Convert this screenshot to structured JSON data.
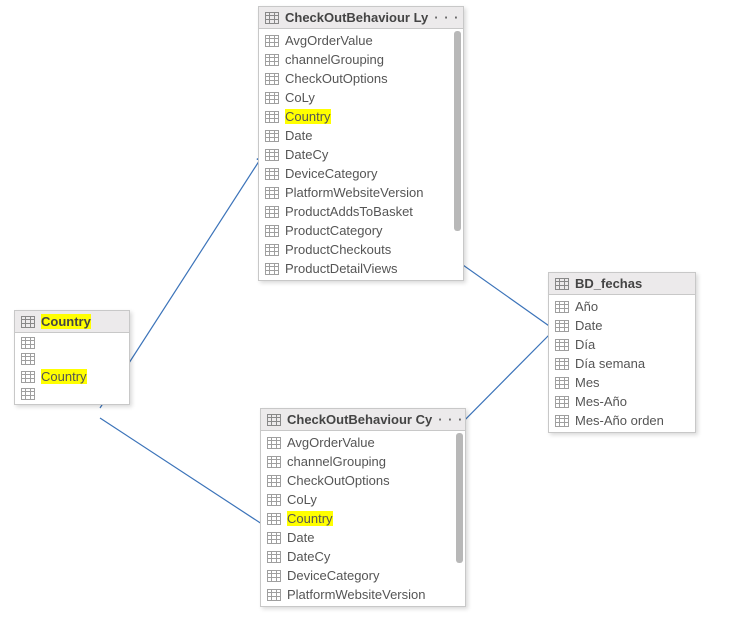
{
  "tables": {
    "country_small": {
      "title": "Country",
      "title_highlight": true,
      "fields": [
        {
          "label": "",
          "highlight": false
        },
        {
          "label": "",
          "highlight": false
        },
        {
          "label": "Country",
          "highlight": true
        },
        {
          "label": "",
          "highlight": false
        }
      ]
    },
    "checkout_ly": {
      "title": "CheckOutBehaviour Ly",
      "ellipsis": "· · ·",
      "fields": [
        {
          "label": "AvgOrderValue",
          "highlight": false
        },
        {
          "label": "channelGrouping",
          "highlight": false
        },
        {
          "label": "CheckOutOptions",
          "highlight": false
        },
        {
          "label": "CoLy",
          "highlight": false
        },
        {
          "label": "Country",
          "highlight": true
        },
        {
          "label": "Date",
          "highlight": false
        },
        {
          "label": "DateCy",
          "highlight": false
        },
        {
          "label": "DeviceCategory",
          "highlight": false
        },
        {
          "label": "PlatformWebsiteVersion",
          "highlight": false
        },
        {
          "label": "ProductAddsToBasket",
          "highlight": false
        },
        {
          "label": "ProductCategory",
          "highlight": false
        },
        {
          "label": "ProductCheckouts",
          "highlight": false
        },
        {
          "label": "ProductDetailViews",
          "highlight": false
        }
      ]
    },
    "checkout_cy": {
      "title": "CheckOutBehaviour Cy",
      "ellipsis": "· · ·",
      "fields": [
        {
          "label": "AvgOrderValue",
          "highlight": false
        },
        {
          "label": "channelGrouping",
          "highlight": false
        },
        {
          "label": "CheckOutOptions",
          "highlight": false
        },
        {
          "label": "CoLy",
          "highlight": false
        },
        {
          "label": "Country",
          "highlight": true
        },
        {
          "label": "Date",
          "highlight": false
        },
        {
          "label": "DateCy",
          "highlight": false
        },
        {
          "label": "DeviceCategory",
          "highlight": false
        },
        {
          "label": "PlatformWebsiteVersion",
          "highlight": false
        }
      ]
    },
    "bd_fechas": {
      "title": "BD_fechas",
      "fields": [
        {
          "label": "Año",
          "highlight": false
        },
        {
          "label": "Date",
          "highlight": false
        },
        {
          "label": "Día",
          "highlight": false
        },
        {
          "label": "Día semana",
          "highlight": false
        },
        {
          "label": "Mes",
          "highlight": false
        },
        {
          "label": "Mes-Año",
          "highlight": false
        },
        {
          "label": "Mes-Año orden",
          "highlight": false
        }
      ]
    }
  },
  "connections": [
    {
      "from": "country_small.Country",
      "to": "checkout_ly.Country"
    },
    {
      "from": "country_small.Country",
      "to": "checkout_cy.Country"
    },
    {
      "from": "bd_fechas.Date",
      "to": "checkout_ly.Date"
    },
    {
      "from": "bd_fechas.Date",
      "to": "checkout_cy.Date"
    }
  ],
  "colors": {
    "highlight": "#ffff00",
    "arrow": "#3b73b9",
    "border": "#c8c8c8",
    "header_bg": "#eceaeb"
  }
}
